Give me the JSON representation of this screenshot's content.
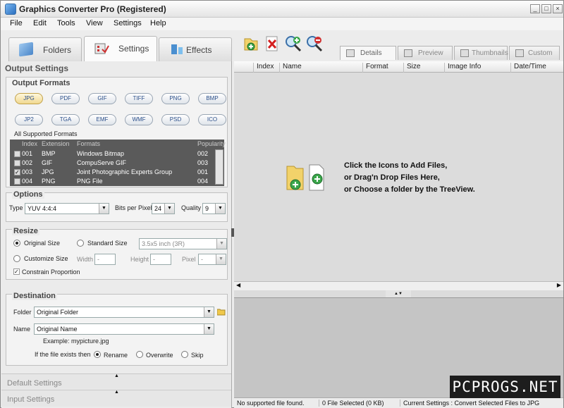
{
  "window": {
    "title": "Graphics Converter Pro  (Registered)",
    "minimize": "_",
    "maximize": "□",
    "close": "×"
  },
  "menu": [
    "File",
    "Edit",
    "Tools",
    "View",
    "Settings",
    "Help"
  ],
  "main_tabs": [
    {
      "label": "Folders",
      "icon": "folder-icon"
    },
    {
      "label": "Settings",
      "icon": "settings-icon"
    },
    {
      "label": "Effects",
      "icon": "effects-icon"
    }
  ],
  "toolbar": [
    "add-files-icon",
    "delete-icon",
    "zoom-in-icon",
    "zoom-out-icon"
  ],
  "view_tabs": [
    "Details",
    "Preview",
    "Thumbnails",
    "Custom"
  ],
  "output_settings": {
    "title": "Output Settings",
    "formats_title": "Output Formats",
    "formats": [
      "JPG",
      "PDF",
      "GIF",
      "TIFF",
      "PNG",
      "BMP",
      "JP2",
      "TGA",
      "EMF",
      "WMF",
      "PSD",
      "ICO"
    ],
    "selected_format": "JPG",
    "all_supported": "All Supported Formats",
    "columns": [
      "Index",
      "Extension",
      "Formats",
      "Popularity"
    ],
    "rows": [
      {
        "index": "001",
        "ext": "BMP",
        "format": "Windows Bitmap",
        "pop": "002",
        "checked": false
      },
      {
        "index": "002",
        "ext": "GIF",
        "format": "CompuServe GIF",
        "pop": "003",
        "checked": false
      },
      {
        "index": "003",
        "ext": "JPG",
        "format": "Joint Photographic Experts Group",
        "pop": "001",
        "checked": true
      },
      {
        "index": "004",
        "ext": "PNG",
        "format": "PNG File",
        "pop": "004",
        "checked": false
      }
    ]
  },
  "options": {
    "title": "Options",
    "type_label": "Type",
    "type_value": "YUV 4:4:4",
    "bpp_label": "Bits per Pixel",
    "bpp_value": "24",
    "quality_label": "Quality",
    "quality_value": "9"
  },
  "resize": {
    "title": "Resize",
    "original": "Original Size",
    "standard": "Standard Size",
    "standard_value": "3.5x5 inch (3R)",
    "customize": "Customize Size",
    "width_label": "Width",
    "width_value": "-",
    "height_label": "Height",
    "height_value": "-",
    "unit_value": "Pixel",
    "unit_sel": "-",
    "constrain": "Constrain Proportion"
  },
  "destination": {
    "title": "Destination",
    "folder_label": "Folder",
    "folder_value": "Original Folder",
    "name_label": "Name",
    "name_value": "Original Name",
    "example": "Example: mypicture.jpg",
    "exists_label": "If the file exists then",
    "rename": "Rename",
    "overwrite": "Overwrite",
    "skip": "Skip"
  },
  "collapsed": {
    "default": "Default Settings",
    "input": "Input Settings"
  },
  "file_list": {
    "columns": [
      "Index",
      "Name",
      "Format",
      "Size",
      "Image Info",
      "Date/Time"
    ],
    "hint": [
      "Click the Icons to Add Files,",
      "or Drag'n Drop Files Here,",
      "or Choose a folder by the TreeView."
    ]
  },
  "status": [
    "No supported file found.",
    "0 File Selected (0 KB)",
    "Current Settings : Convert Selected Files to JPG"
  ],
  "watermark": "PCPROGS.NET"
}
